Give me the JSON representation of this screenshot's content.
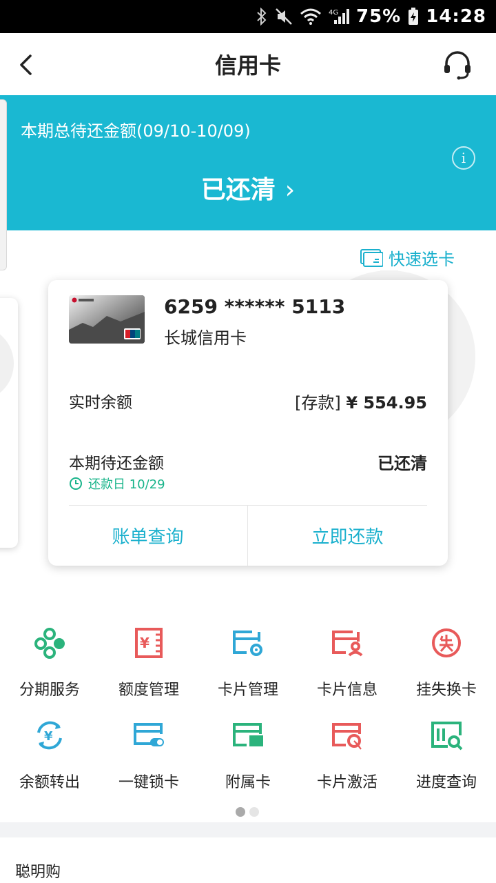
{
  "status_bar": {
    "battery": "75%",
    "time": "14:28",
    "network": "4G"
  },
  "nav": {
    "title": "信用卡"
  },
  "banner": {
    "subtitle": "本期总待还金额(09/10-10/09)",
    "status": "已还清",
    "color": "#1ab8d2"
  },
  "quick_select": {
    "label": "快速选卡"
  },
  "card": {
    "number": "6259 ****** 5113",
    "name": "长城信用卡",
    "balance_label": "实时余额",
    "balance_tag": "[存款]",
    "balance_value": "¥ 554.95",
    "due_label": "本期待还金额",
    "due_value": "已还清",
    "due_date": "还款日 10/29",
    "actions": [
      "账单查询",
      "立即还款"
    ]
  },
  "services": [
    {
      "label": "分期服务",
      "icon": "installment-icon",
      "color": "#2bb37c"
    },
    {
      "label": "额度管理",
      "icon": "credit-limit-icon",
      "color": "#e85a5a"
    },
    {
      "label": "卡片管理",
      "icon": "card-settings-icon",
      "color": "#2fa7d6"
    },
    {
      "label": "卡片信息",
      "icon": "card-info-icon",
      "color": "#e85a5a"
    },
    {
      "label": "挂失换卡",
      "icon": "report-loss-icon",
      "color": "#e85a5a"
    },
    {
      "label": "余额转出",
      "icon": "balance-transfer-icon",
      "color": "#2fa7d6"
    },
    {
      "label": "一键锁卡",
      "icon": "lock-card-icon",
      "color": "#2fa7d6"
    },
    {
      "label": "附属卡",
      "icon": "supplementary-card-icon",
      "color": "#2bb37c"
    },
    {
      "label": "卡片激活",
      "icon": "card-activate-icon",
      "color": "#e85a5a"
    },
    {
      "label": "进度查询",
      "icon": "progress-search-icon",
      "color": "#2bb37c"
    }
  ],
  "pager": {
    "pages": 2,
    "current": 1
  },
  "section": {
    "title": "聪明购"
  },
  "accent_color": "#1ab0cd",
  "success_color": "#18b48a"
}
